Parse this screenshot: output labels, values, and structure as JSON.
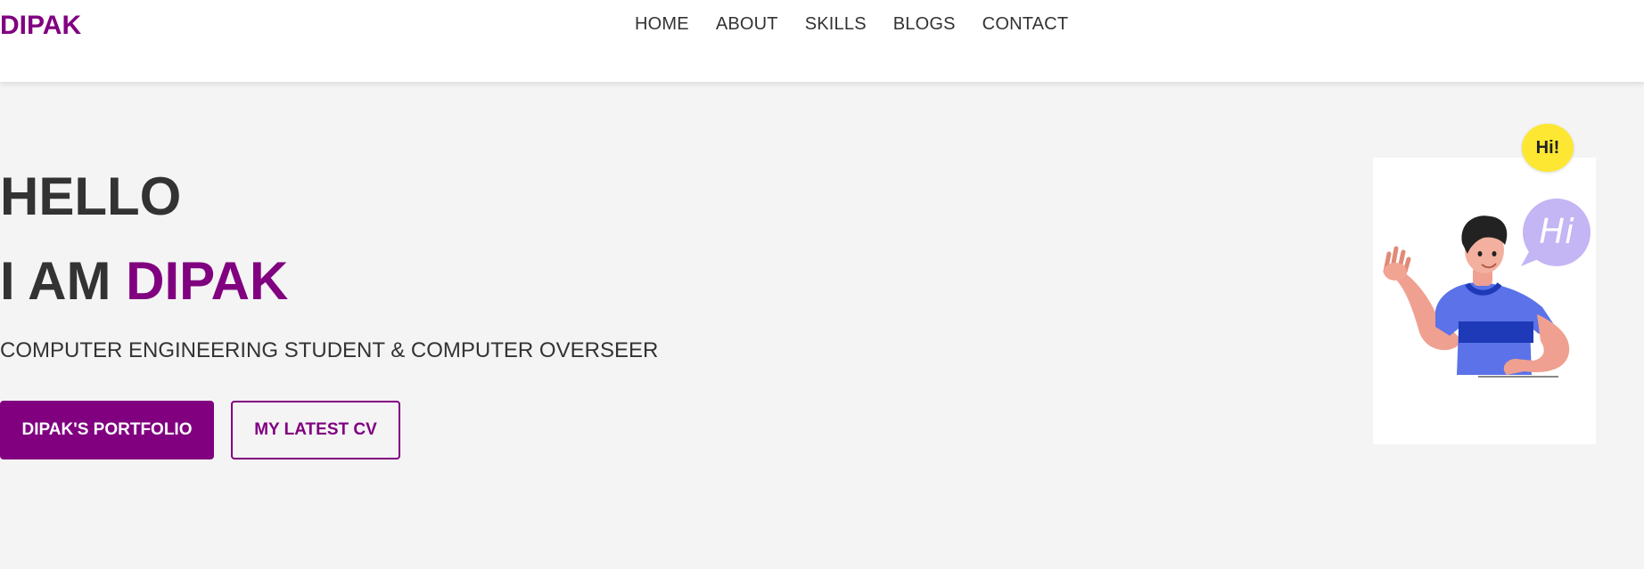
{
  "nav": {
    "logo": "DIPAK",
    "links": [
      "HOME",
      "ABOUT",
      "SKILLS",
      "BLOGS",
      "CONTACT"
    ]
  },
  "hero": {
    "line1": "HELLO",
    "line2_prefix": "I AM",
    "line2_name": "DIPAK",
    "subtitle": "COMPUTER ENGINEERING STUDENT & COMPUTER OVERSEER",
    "buttons": {
      "primary": "DIPAK'S PORTFOLIO",
      "secondary": "MY LATEST CV"
    }
  },
  "illustration": {
    "badge": "Hi!",
    "bubble": "Hi"
  },
  "colors": {
    "accent": "#800080",
    "text": "#333333",
    "background": "#f4f4f4",
    "badge": "#fde733",
    "bubble": "#c4b5f4",
    "shirt": "#5b72e8"
  }
}
